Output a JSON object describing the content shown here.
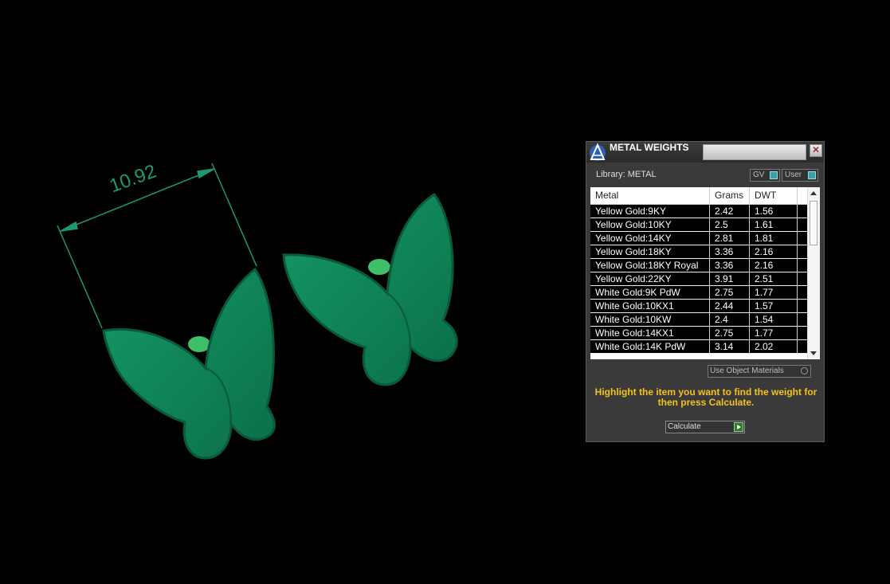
{
  "viewport": {
    "dimension_value": "10.92",
    "colors": {
      "background": "#000000",
      "model": "#0e7f55",
      "dimension": "#1e9a6a"
    }
  },
  "panel": {
    "title": "METAL WEIGHTS",
    "close_icon": "close-icon",
    "logo_icon": "app-logo-icon",
    "library_label": "Library: METAL",
    "toggles": {
      "gv": "GV",
      "user": "User"
    },
    "table": {
      "headers": [
        "Metal",
        "Grams",
        "DWT"
      ],
      "rows": [
        [
          "Yellow Gold:9KY",
          "2.42",
          "1.56"
        ],
        [
          "Yellow Gold:10KY",
          "2.5",
          "1.61"
        ],
        [
          "Yellow Gold:14KY",
          "2.81",
          "1.81"
        ],
        [
          "Yellow Gold:18KY",
          "3.36",
          "2.16"
        ],
        [
          "Yellow Gold:18KY Royal",
          "3.36",
          "2.16"
        ],
        [
          "Yellow Gold:22KY",
          "3.91",
          "2.51"
        ],
        [
          "White Gold:9K PdW",
          "2.75",
          "1.77"
        ],
        [
          "White Gold:10KX1",
          "2.44",
          "1.57"
        ],
        [
          "White Gold:10KW",
          "2.4",
          "1.54"
        ],
        [
          "White Gold:14KX1",
          "2.75",
          "1.77"
        ],
        [
          "White Gold:14K PdW",
          "3.14",
          "2.02"
        ]
      ]
    },
    "use_object_materials": "Use Object Materials",
    "hint": "Highlight the item you want to find the weight for then press Calculate.",
    "calculate_label": "Calculate",
    "colors": {
      "accent": "#f3c21b",
      "panel_bg": "#3a3a3a",
      "toggle_knob": "#3aa0a8",
      "go": "#2d7a2d"
    }
  }
}
